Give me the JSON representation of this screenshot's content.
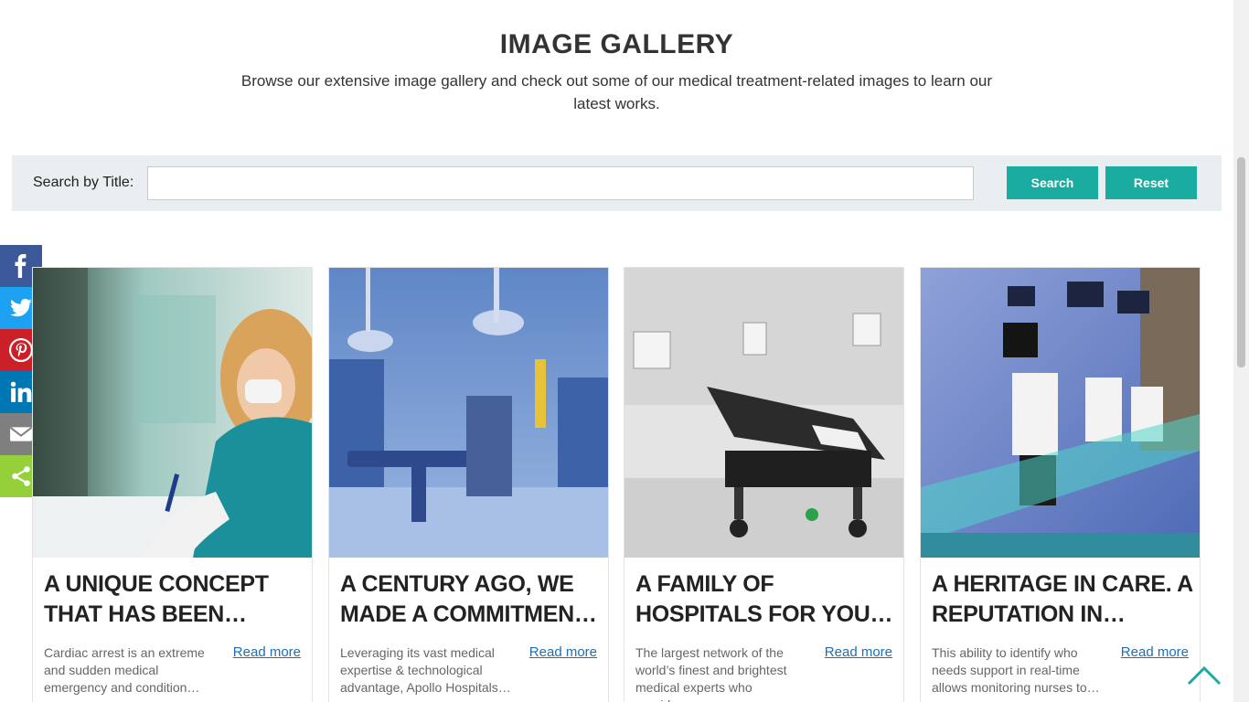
{
  "hero": {
    "title": "IMAGE GALLERY",
    "subtitle": "Browse our extensive image gallery and check out some of our medical treatment-related images to learn our latest works."
  },
  "search": {
    "label": "Search by Title:",
    "value": "",
    "placeholder": "",
    "search_button": "Search",
    "reset_button": "Reset"
  },
  "share": {
    "items": [
      {
        "name": "facebook",
        "icon": "facebook-icon",
        "color": "#3b5998"
      },
      {
        "name": "twitter",
        "icon": "twitter-icon",
        "color": "#1da1f2"
      },
      {
        "name": "pinterest",
        "icon": "pinterest-icon",
        "color": "#cb2027"
      },
      {
        "name": "linkedin",
        "icon": "linkedin-icon",
        "color": "#0077b5"
      },
      {
        "name": "email",
        "icon": "email-icon",
        "color": "#7f7f7f"
      },
      {
        "name": "share",
        "icon": "share-icon",
        "color": "#95d03a"
      }
    ]
  },
  "gallery": {
    "cards": [
      {
        "title": "A UNIQUE CONCEPT THAT HAS BEEN…",
        "description": "Cardiac arrest is an extreme and sudden medical emergency and condition…",
        "link": "Read more",
        "image": "nurse-writing-photo"
      },
      {
        "title": "A CENTURY AGO, WE MADE A COMMITMEN…",
        "description": "Leveraging its vast medical expertise & technological advantage, Apollo Hospitals…",
        "link": "Read more",
        "image": "operating-theatre-photo"
      },
      {
        "title": "A FAMILY OF HOSPITALS FOR YOU…",
        "description": "The largest network of the world’s finest and brightest medical experts who provide…",
        "link": "Read more",
        "image": "hospital-stretcher-photo"
      },
      {
        "title": "A HERITAGE IN CARE. A REPUTATION IN…",
        "description": "This ability to identify who needs support in real-time allows monitoring nurses to…",
        "link": "Read more",
        "image": "ultrasound-machines-photo"
      }
    ]
  },
  "colors": {
    "accent": "#1aaba1",
    "link": "#1f6fb2",
    "search_bar_bg": "#e9eef1"
  }
}
